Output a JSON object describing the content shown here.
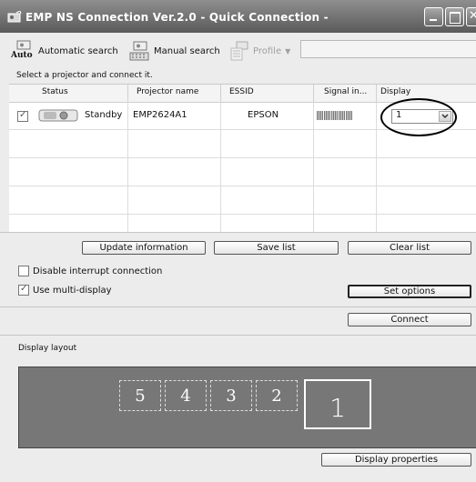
{
  "window": {
    "title": "EMP NS Connection Ver.2.0 - Quick Connection -"
  },
  "toolbar": {
    "auto_badge": "Auto",
    "automatic_search": "Automatic search",
    "manual_search": "Manual search",
    "profile": "Profile"
  },
  "hint": "Select a projector and connect it.",
  "table": {
    "columns": [
      "Status",
      "Projector name",
      "ESSID",
      "Signal in...",
      "Display"
    ],
    "rows": [
      {
        "checked": true,
        "status": "Standby",
        "projector_name": "EMP2624A1",
        "essid": "EPSON",
        "signal_bars": 5,
        "display": "1"
      }
    ]
  },
  "buttons": {
    "update_information": "Update information",
    "save_list": "Save list",
    "clear_list": "Clear list",
    "set_options": "Set options",
    "connect": "Connect",
    "display_properties": "Display properties"
  },
  "options": {
    "disable_interrupt": {
      "label": "Disable interrupt connection",
      "checked": false
    },
    "use_multi_display": {
      "label": "Use multi-display",
      "checked": true
    }
  },
  "display_layout": {
    "label": "Display layout",
    "slots": [
      "5",
      "4",
      "3",
      "2"
    ],
    "main": "1"
  }
}
